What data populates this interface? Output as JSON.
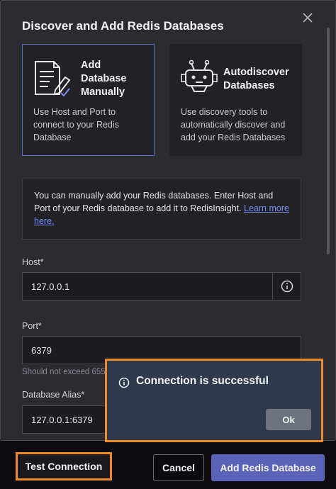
{
  "modal": {
    "title": "Discover and Add Redis Databases",
    "cards": [
      {
        "title_lines": [
          "Add",
          "Database",
          "Manually"
        ],
        "description": "Use Host and Port to connect to your Redis Database",
        "selected": true,
        "icon": "document-edit-icon"
      },
      {
        "title_lines": [
          "Autodiscover",
          "Databases"
        ],
        "description": "Use discovery tools to automatically discover and add your Redis Databases",
        "selected": false,
        "icon": "robot-icon"
      }
    ],
    "info_text": "You can manually add your Redis databases. Enter Host and Port of your Redis database to add it to RedisInsight.",
    "info_link": "Learn more here.",
    "host": {
      "label": "Host*",
      "value": "127.0.0.1"
    },
    "port": {
      "label": "Port*",
      "value": "6379",
      "hint": "Should not exceed 655"
    },
    "alias": {
      "label": "Database Alias*",
      "value": "127.0.0.1:6379"
    }
  },
  "toast": {
    "message": "Connection is successful",
    "ok_label": "Ok"
  },
  "footer": {
    "test_label": "Test Connection",
    "cancel_label": "Cancel",
    "add_label": "Add Redis Database"
  },
  "colors": {
    "accent": "#5a63b8",
    "highlight": "#f08a24",
    "link": "#7b8cf5"
  }
}
